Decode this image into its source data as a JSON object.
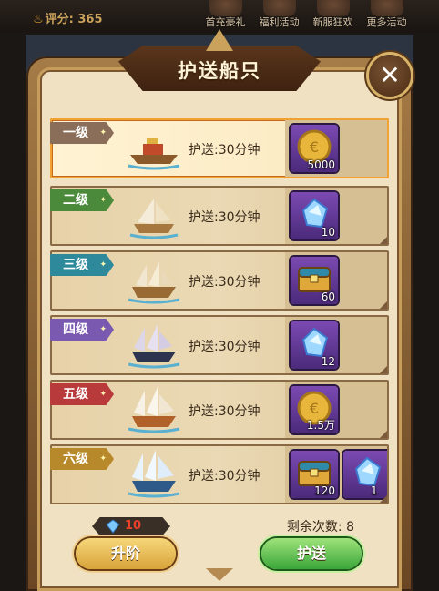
{
  "header": {
    "score_label": "评分: 365",
    "nav": [
      {
        "label": "首充豪礼",
        "icon": "gift-icon"
      },
      {
        "label": "福利活动",
        "icon": "welfare-icon"
      },
      {
        "label": "新服狂欢",
        "icon": "carnival-icon"
      },
      {
        "label": "更多活动",
        "icon": "more-icon"
      }
    ]
  },
  "dialog": {
    "title": "护送船只",
    "close_icon": "close-icon",
    "tiers": [
      {
        "tier": "一级",
        "color": "#8a6e5a",
        "ship_icon": "ship-tier1-icon",
        "escort": "护送:30分钟",
        "selected": true,
        "rewards": [
          {
            "icon": "gold-coin-icon",
            "count": "5000"
          }
        ]
      },
      {
        "tier": "二级",
        "color": "#4a8a3a",
        "ship_icon": "ship-tier2-icon",
        "escort": "护送:30分钟",
        "rewards": [
          {
            "icon": "diamond-icon",
            "count": "10"
          }
        ]
      },
      {
        "tier": "三级",
        "color": "#2e8a9a",
        "ship_icon": "ship-tier3-icon",
        "escort": "护送:30分钟",
        "rewards": [
          {
            "icon": "treasure-chest-icon",
            "count": "60"
          }
        ]
      },
      {
        "tier": "四级",
        "color": "#7a5ab0",
        "ship_icon": "ship-tier4-icon",
        "escort": "护送:30分钟",
        "rewards": [
          {
            "icon": "diamond-icon",
            "count": "12"
          }
        ]
      },
      {
        "tier": "五级",
        "color": "#b83a3a",
        "ship_icon": "ship-tier5-icon",
        "escort": "护送:30分钟",
        "rewards": [
          {
            "icon": "gold-coin-icon",
            "count": "1.5万"
          }
        ]
      },
      {
        "tier": "六级",
        "color": "#b8892a",
        "ship_icon": "ship-tier6-icon",
        "escort": "护送:30分钟",
        "rewards": [
          {
            "icon": "treasure-chest-icon",
            "count": "120"
          },
          {
            "icon": "diamond-icon",
            "count": "1"
          }
        ]
      }
    ]
  },
  "footer": {
    "cost_icon": "diamond-icon",
    "cost_value": "10",
    "remaining_label": "剩余次数: 8",
    "upgrade_label": "升阶",
    "escort_label": "护送"
  }
}
